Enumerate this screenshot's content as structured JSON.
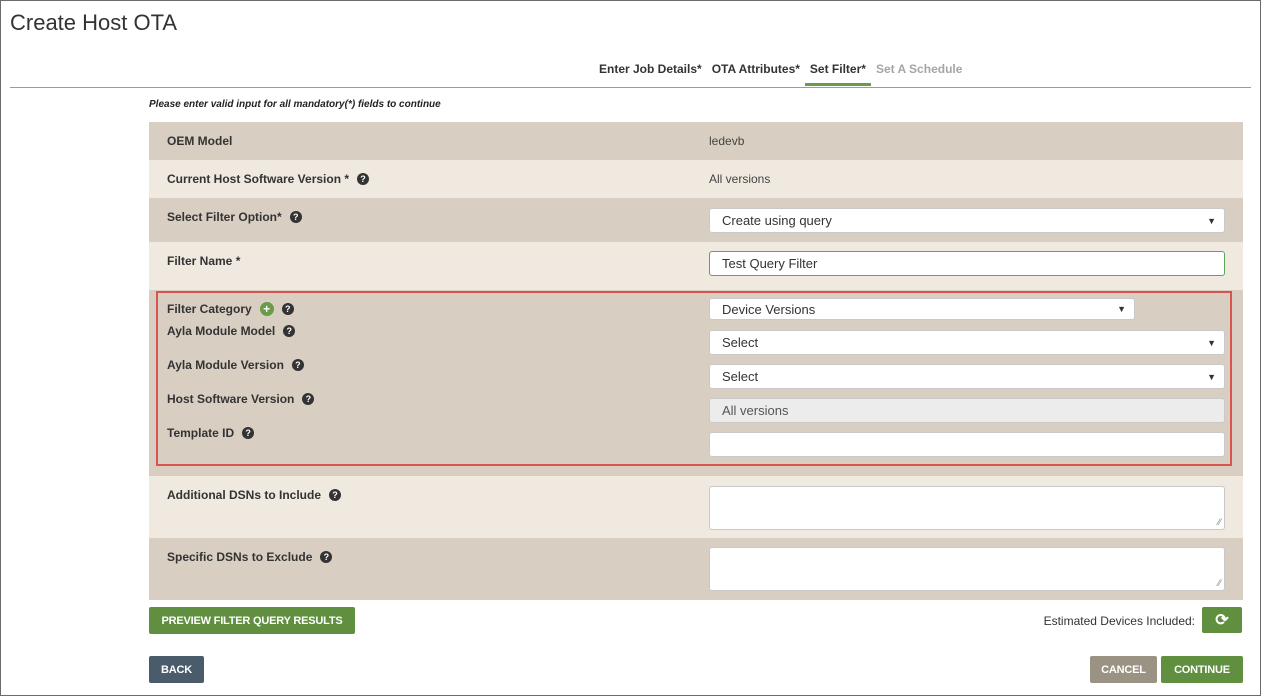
{
  "page": {
    "title": "Create Host OTA"
  },
  "tabs": [
    {
      "label": "Enter Job Details*",
      "state": "done"
    },
    {
      "label": "OTA Attributes*",
      "state": "done"
    },
    {
      "label": "Set Filter*",
      "state": "active"
    },
    {
      "label": "Set A Schedule",
      "state": "disabled"
    }
  ],
  "notice": "Please enter valid input for all mandatory(*) fields to continue",
  "form": {
    "oem_model": {
      "label": "OEM Model",
      "value": "ledevb"
    },
    "current_host_version": {
      "label": "Current Host Software Version *",
      "value": "All versions"
    },
    "filter_option": {
      "label": "Select Filter Option*",
      "value": "Create using query"
    },
    "filter_name": {
      "label": "Filter Name *",
      "value": "Test Query Filter"
    },
    "filter_category": {
      "label": "Filter Category",
      "value": "Device Versions"
    },
    "module_model": {
      "label": "Ayla Module Model",
      "value": "Select"
    },
    "module_version": {
      "label": "Ayla Module Version",
      "value": "Select"
    },
    "host_version": {
      "label": "Host Software Version",
      "value": "All versions"
    },
    "template_id": {
      "label": "Template ID",
      "value": ""
    },
    "dsn_include": {
      "label": "Additional DSNs to Include",
      "value": ""
    },
    "dsn_exclude": {
      "label": "Specific DSNs to Exclude",
      "value": ""
    }
  },
  "buttons": {
    "preview": "PREVIEW FILTER QUERY RESULTS",
    "back": "BACK",
    "cancel": "CANCEL",
    "continue": "CONTINUE"
  },
  "estimate": {
    "label": "Estimated Devices Included:"
  },
  "icons": {
    "help": "question-circle-icon",
    "add": "plus-circle-icon",
    "refresh": "refresh-icon",
    "caret": "caret-down-icon"
  },
  "colors": {
    "accent_green": "#5f8f3f",
    "row_dark": "#d8cfc2",
    "row_light": "#efe9e0",
    "highlight": "#d9534f",
    "back_button": "#4a5c6c"
  }
}
